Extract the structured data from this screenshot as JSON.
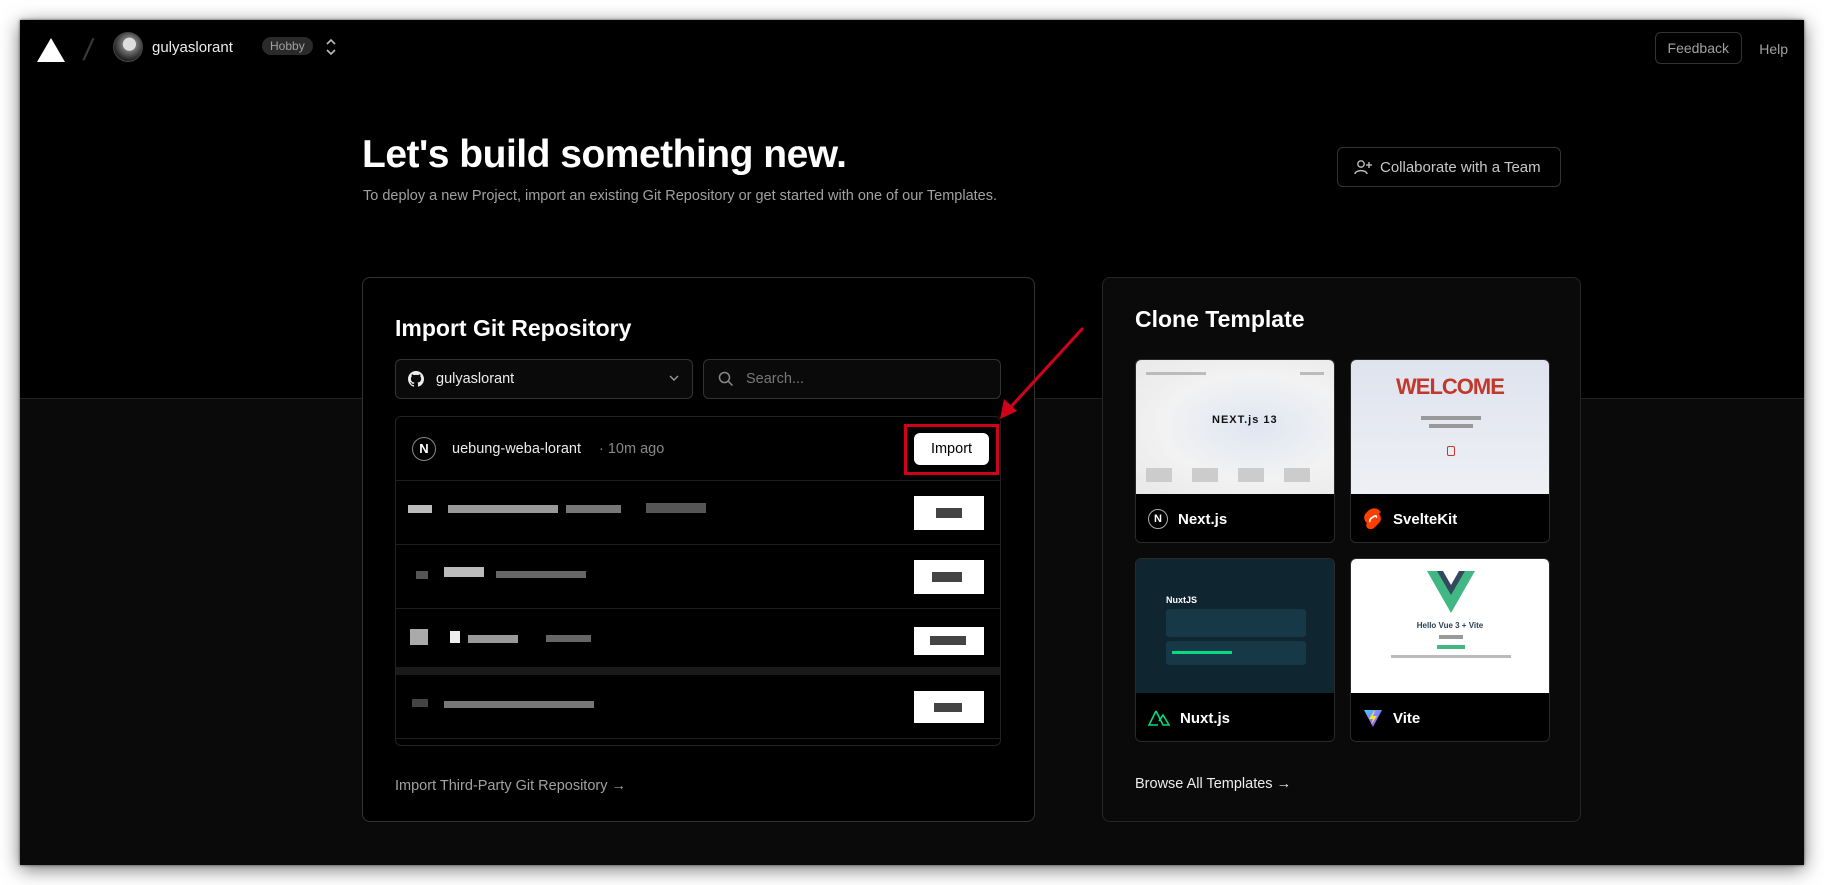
{
  "header": {
    "account_name": "gulyaslorant",
    "plan_badge": "Hobby",
    "feedback_label": "Feedback",
    "help_label": "Help"
  },
  "hero": {
    "title": "Let's build something new.",
    "subtitle": "To deploy a new Project, import an existing Git Repository or get started with one of our Templates.",
    "collab_label": "Collaborate with a Team"
  },
  "import_panel": {
    "title": "Import Git Repository",
    "scope_value": "gulyaslorant",
    "search_placeholder": "Search...",
    "repos": [
      {
        "name": "uebung-weba-lorant",
        "meta": "· 10m ago",
        "icon_letter": "N",
        "button_label": "Import"
      }
    ],
    "third_party_label": "Import Third-Party Git Repository →"
  },
  "clone_panel": {
    "title": "Clone Template",
    "templates": [
      {
        "label": "Next.js",
        "icon": "nextjs-icon"
      },
      {
        "label": "SvelteKit",
        "icon": "svelte-icon"
      },
      {
        "label": "Nuxt.js",
        "icon": "nuxt-icon"
      },
      {
        "label": "Vite",
        "icon": "vite-icon"
      }
    ],
    "browse_label": "Browse All Templates →"
  },
  "thumbnails": {
    "next_text": "NEXT.js 13",
    "svelte_welcome": "WELCOME",
    "nuxt_brand": "NuxtJS",
    "vite_heading": "Hello Vue 3 + Vite"
  },
  "colors": {
    "annotation_red": "#d0021b",
    "background": "#000000",
    "border": "#333333"
  }
}
